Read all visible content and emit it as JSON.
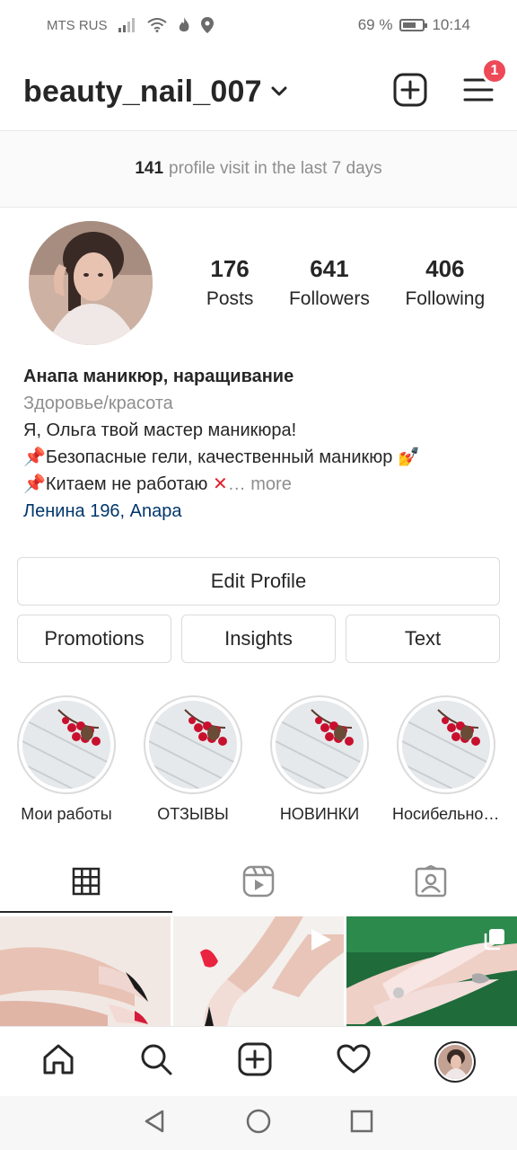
{
  "status_bar": {
    "carrier": "MTS RUS",
    "battery_percent": "69 %",
    "battery_level": 0.69,
    "time": "10:14"
  },
  "header": {
    "username": "beauty_nail_007",
    "notification_count": "1"
  },
  "visits": {
    "count": "141",
    "text": "profile visit in the last 7 days"
  },
  "profile": {
    "stats": [
      {
        "value": "176",
        "label": "Posts"
      },
      {
        "value": "641",
        "label": "Followers"
      },
      {
        "value": "406",
        "label": "Following"
      }
    ],
    "name": "Анапа маникюр, наращивание",
    "category": "Здоровье/красота",
    "bio_line1": "Я, Ольга твой мастер маникюра!",
    "bio_line2": "Безопасные гели, качественный маникюр",
    "bio_line3": "Китаем не работаю",
    "more_label": "… more",
    "location": "Ленина 196, Anapa"
  },
  "buttons": {
    "edit_profile": "Edit Profile",
    "promotions": "Promotions",
    "insights": "Insights",
    "text": "Text"
  },
  "highlights": [
    {
      "label": "Мои работы"
    },
    {
      "label": "ОТЗЫВЫ"
    },
    {
      "label": "НОВИНКИ"
    },
    {
      "label": "Носибельность"
    }
  ],
  "tabs": [
    {
      "icon": "grid-icon",
      "active": true
    },
    {
      "icon": "reels-icon",
      "active": false
    },
    {
      "icon": "tagged-icon",
      "active": false
    }
  ],
  "bottom_nav": [
    "home-icon",
    "search-icon",
    "create-icon",
    "activity-icon",
    "profile-avatar"
  ],
  "colors": {
    "badge": "#ed4956",
    "text": "#262626",
    "secondary": "#8e8e8e",
    "link": "#00376b",
    "border": "#dbdbdb"
  }
}
